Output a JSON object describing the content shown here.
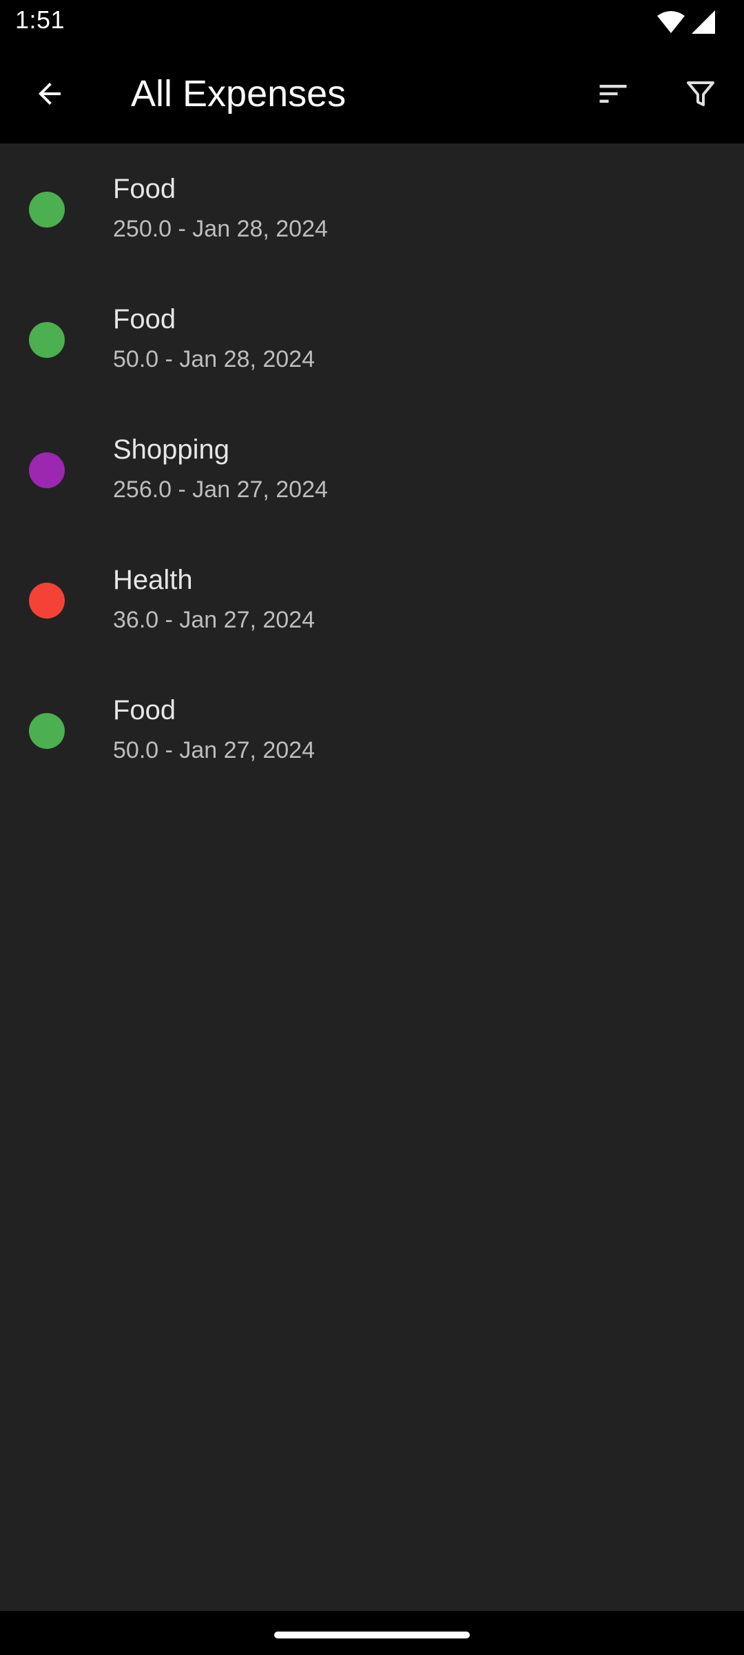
{
  "status_bar": {
    "time": "1:51"
  },
  "app_bar": {
    "title": "All Expenses",
    "back_icon": "arrow-back-icon",
    "sort_icon": "sort-icon",
    "filter_icon": "filter-icon"
  },
  "expenses": [
    {
      "category": "Food",
      "detail": "250.0 - Jan 28, 2024",
      "color": "#4caf50"
    },
    {
      "category": "Food",
      "detail": "50.0 - Jan 28, 2024",
      "color": "#4caf50"
    },
    {
      "category": "Shopping",
      "detail": "256.0 - Jan 27, 2024",
      "color": "#9c27b0"
    },
    {
      "category": "Health",
      "detail": "36.0 - Jan 27, 2024",
      "color": "#f44336"
    },
    {
      "category": "Food",
      "detail": "50.0 - Jan 27, 2024",
      "color": "#4caf50"
    }
  ],
  "theme": {
    "background": "#222222",
    "bar_background": "#000000"
  }
}
